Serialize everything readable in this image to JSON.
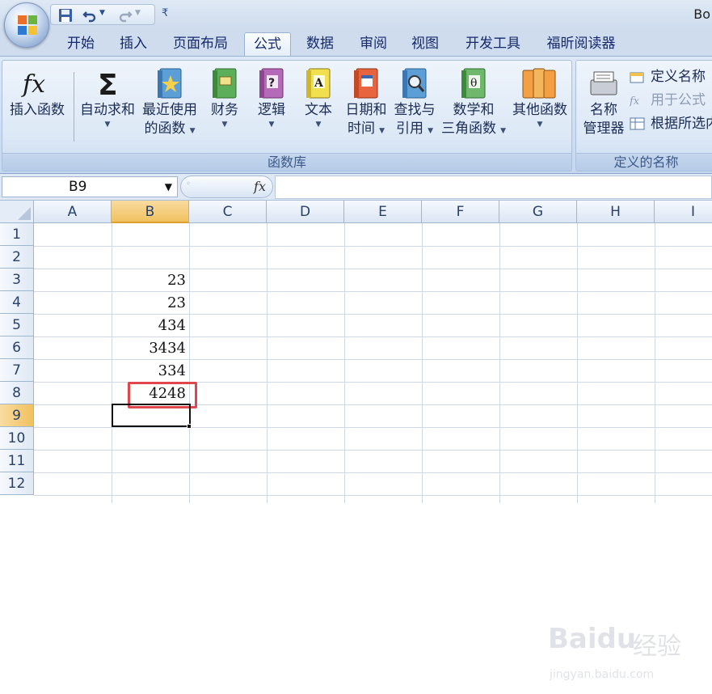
{
  "window": {
    "title": "Bo"
  },
  "tabs": [
    {
      "label": "开始",
      "active": false
    },
    {
      "label": "插入",
      "active": false
    },
    {
      "label": "页面布局",
      "active": false
    },
    {
      "label": "公式",
      "active": true
    },
    {
      "label": "数据",
      "active": false
    },
    {
      "label": "审阅",
      "active": false
    },
    {
      "label": "视图",
      "active": false
    },
    {
      "label": "开发工具",
      "active": false
    },
    {
      "label": "福昕阅读器",
      "active": false
    }
  ],
  "ribbon": {
    "insert_function": {
      "label": "插入函数"
    },
    "function_library": {
      "label": "函数库",
      "buttons": [
        {
          "line1": "自动求和",
          "line2": ""
        },
        {
          "line1": "最近使用",
          "line2": "的函数"
        },
        {
          "line1": "财务",
          "line2": ""
        },
        {
          "line1": "逻辑",
          "line2": ""
        },
        {
          "line1": "文本",
          "line2": ""
        },
        {
          "line1": "日期和",
          "line2": "时间"
        },
        {
          "line1": "查找与",
          "line2": "引用"
        },
        {
          "line1": "数学和",
          "line2": "三角函数"
        },
        {
          "line1": "其他函数",
          "line2": ""
        }
      ]
    },
    "defined_names": {
      "label": "定义的名称",
      "name_manager_line1": "名称",
      "name_manager_line2": "管理器",
      "define_name": "定义名称",
      "use_in_formula": "用于公式",
      "create_from_selection": "根据所选内"
    }
  },
  "formula_bar": {
    "name_box": "B9",
    "fx": "fx",
    "formula": ""
  },
  "sheet": {
    "columns": [
      "A",
      "B",
      "C",
      "D",
      "E",
      "F",
      "G",
      "H",
      "I"
    ],
    "selected_column": "B",
    "rows": [
      "1",
      "2",
      "3",
      "4",
      "5",
      "6",
      "7",
      "8",
      "9",
      "10",
      "11",
      "12"
    ],
    "selected_row": "9",
    "cells": [
      {
        "ref": "B3",
        "value": "23"
      },
      {
        "ref": "B4",
        "value": "23"
      },
      {
        "ref": "B5",
        "value": "434"
      },
      {
        "ref": "B6",
        "value": "3434"
      },
      {
        "ref": "B7",
        "value": "334"
      },
      {
        "ref": "B8",
        "value": "4248"
      }
    ],
    "active_cell": "B9",
    "highlighted_cell": "B8"
  },
  "watermark": {
    "brand": "Bai",
    "brand2": "du",
    "cn": "经验",
    "url": "jingyan.baidu.com"
  },
  "colors": {
    "highlight": "#e0464c",
    "selected_header": "#f1c15f",
    "ribbon_bg": "#dde8f6"
  }
}
